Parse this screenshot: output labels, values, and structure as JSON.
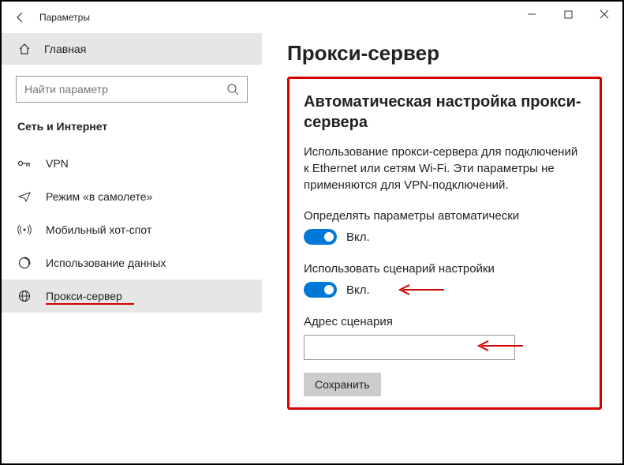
{
  "titlebar": {
    "app_name": "Параметры"
  },
  "sidebar": {
    "home_label": "Главная",
    "search_placeholder": "Найти параметр",
    "category": "Сеть и Интернет",
    "items": [
      {
        "label": "VPN"
      },
      {
        "label": "Режим «в самолете»"
      },
      {
        "label": "Мобильный хот-спот"
      },
      {
        "label": "Использование данных"
      },
      {
        "label": "Прокси-сервер"
      }
    ]
  },
  "page": {
    "title": "Прокси-сервер",
    "section_title": "Автоматическая настройка прокси-сервера",
    "description": "Использование прокси-сервера для подключений к Ethernet или сетям Wi-Fi. Эти параметры не применяются для VPN-подключений.",
    "auto_detect_label": "Определять параметры автоматически",
    "auto_detect_state": "Вкл.",
    "use_script_label": "Использовать сценарий настройки",
    "use_script_state": "Вкл.",
    "script_address_label": "Адрес сценария",
    "script_address_value": "",
    "save_button": "Сохранить"
  }
}
